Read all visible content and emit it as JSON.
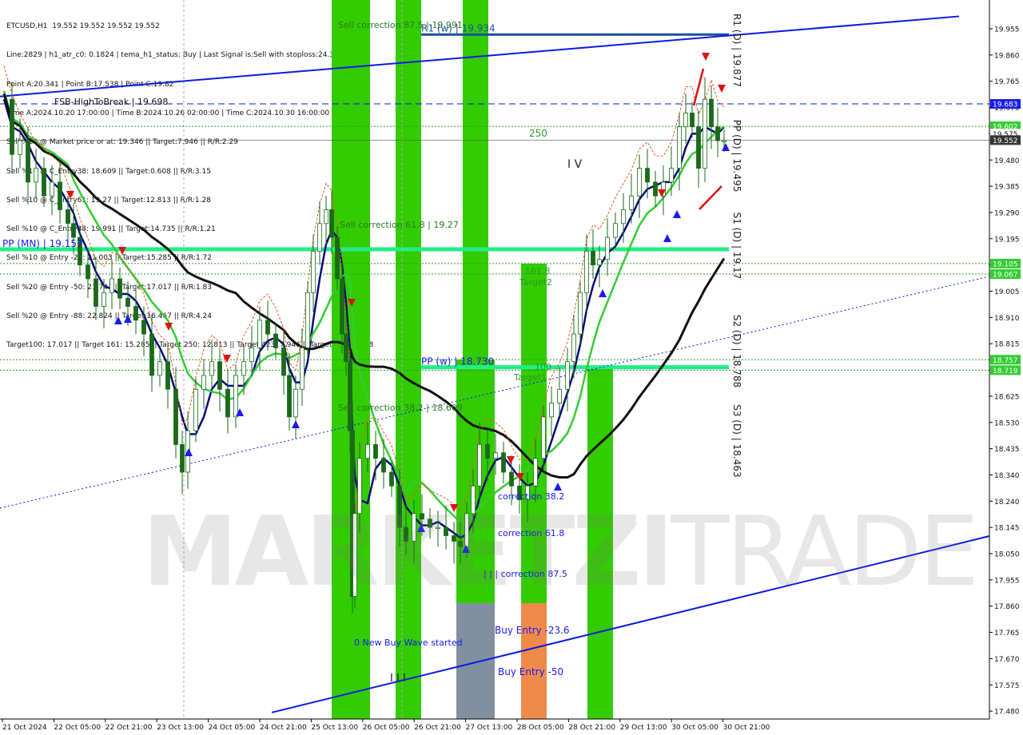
{
  "header": {
    "lines": [
      "ETCUSD,H1  19.552 19.552 19.552 19.552",
      "Line:2829 | h1_atr_c0: 0.1824 | tema_h1_status: Buy | Last Signal is:Sell with stoploss:24.323",
      "Point A:20.341 | Point B:17.538 | Point C:19.82",
      "Time A:2024.10.20 17:00:00 | Time B:2024.10.26 02:00:00 | Time C:2024.10.30 16:00:00",
      "Sell %20 @ Market price or at: 19.346 || Target:7.946 || R/R:2.29",
      "Sell %10 @ C_Entry38: 18.609 || Target:0.608 || R/R:3.15",
      "Sell %10 @ C_Entry61: 19.27 || Target:12.813 || R/R:1.28",
      "Sell %10 @ C_Entry88: 19.991 || Target:14.735 || R/R:1.21",
      "Sell %10 @ Entry -23: 21.003 || Target:15.285 || R/R:1.72",
      "Sell %20 @ Entry -50: 21.743 || Target:17.017 || R/R:1.83",
      "Sell %20 @ Entry -88: 22.824 || Target:16.467 || R/R:4.24",
      "Target100: 17.017 || Target 161: 15.285 || Target 250: 12.813 || Target 423: 7.946 || Target 685: 0.608"
    ]
  },
  "watermark": {
    "bold": "MARKETZI",
    "thin": "TRADE"
  },
  "colors": {
    "bg": "#ffffff",
    "green_zone": "#33cc00",
    "orange_zone": "#f08a4b",
    "gray_zone": "#8090a0",
    "blue": "#0a1ae6",
    "pivot": "#1a4fa0",
    "pivot_green": "#22ee88",
    "price_tag": "#333333",
    "green_tag": "#33cc33",
    "blue_tag": "#1a1aee"
  },
  "chart_data": {
    "type": "candlestick",
    "symbol": "ETCUSD",
    "timeframe": "H1",
    "ylim": [
      17.48,
      20.0
    ],
    "y_ticks": [
      "19.955",
      "19.860",
      "19.765",
      "19.670",
      "19.575",
      "19.480",
      "19.385",
      "19.290",
      "19.195",
      "19.100",
      "19.005",
      "18.910",
      "18.815",
      "18.720",
      "18.625",
      "18.530",
      "18.435",
      "18.340",
      "18.240",
      "18.145",
      "18.050",
      "17.955",
      "17.860",
      "17.765",
      "17.670",
      "17.575",
      "17.480"
    ],
    "x_ticks": [
      "21 Oct 2024",
      "22 Oct 05:00",
      "22 Oct 21:00",
      "23 Oct 13:00",
      "24 Oct 05:00",
      "24 Oct 21:00",
      "25 Oct 13:00",
      "26 Oct 05:00",
      "26 Oct 21:00",
      "27 Oct 13:00",
      "28 Oct 05:00",
      "28 Oct 21:00",
      "29 Oct 13:00",
      "30 Oct 05:00",
      "30 Oct 21:00"
    ],
    "price_tags": [
      {
        "text": "19.683",
        "value": 19.683,
        "kind": "blue"
      },
      {
        "text": "19.602",
        "value": 19.602,
        "kind": "green"
      },
      {
        "text": "19.575",
        "value": 19.575,
        "kind": "plain"
      },
      {
        "text": "19.552",
        "value": 19.552,
        "kind": "dark"
      },
      {
        "text": "19.105",
        "value": 19.105,
        "kind": "green"
      },
      {
        "text": "19.067",
        "value": 19.067,
        "kind": "green"
      },
      {
        "text": "18.757",
        "value": 18.757,
        "kind": "green"
      },
      {
        "text": "18.719",
        "value": 18.719,
        "kind": "green"
      }
    ],
    "levels": [
      {
        "label": "R1 (w) | 19.934",
        "value": 19.934,
        "style": "weekly"
      },
      {
        "label": "PP (MN) | 19.157",
        "value": 19.157,
        "style": "monthly"
      },
      {
        "label": "PP (w) | 18.730",
        "value": 18.73,
        "style": "monthly"
      }
    ],
    "daily_pivots": [
      {
        "label": "R1 (D) | 19.877",
        "value": 19.877
      },
      {
        "label": "PP (D) | 19.495",
        "value": 19.495
      },
      {
        "label": "S1 (D) | 19.17",
        "value": 19.17
      },
      {
        "label": "S2 (D) | 18.788",
        "value": 18.788
      },
      {
        "label": "S3 (D) | 18.463",
        "value": 18.463
      }
    ],
    "annotations": [
      {
        "text": "Sell correction 87.5 | 19.991",
        "color": "#2a7a2a"
      },
      {
        "text": "Sell correction 61.8 | 19.27",
        "color": "#2a7a2a"
      },
      {
        "text": "Sell correction 38.2 | 18.609",
        "color": "#2a7a2a"
      },
      {
        "text": "250",
        "color": "#2a9a2a"
      },
      {
        "text": "161.8",
        "color": "#2a9a2a"
      },
      {
        "text": "Target2",
        "color": "#2a9a2a"
      },
      {
        "text": "100",
        "color": "#2a9a2a"
      },
      {
        "text": "Target1",
        "color": "#2a9a2a"
      },
      {
        "text": "I V",
        "color": "#222"
      },
      {
        "text": "I I I",
        "color": "#222"
      },
      {
        "text": "correction 38.2",
        "color": "#1a1aee"
      },
      {
        "text": "correction 61.8",
        "color": "#1a1aee"
      },
      {
        "text": "| | | correction 87.5",
        "color": "#1a1aee"
      },
      {
        "text": "0 New Buy Wave started",
        "color": "#1a1aee"
      },
      {
        "text": "Buy Entry -23.6",
        "color": "#1a1aee"
      },
      {
        "text": "Buy Entry -50",
        "color": "#1a1aee"
      },
      {
        "text": "FSB-HighToBreak | 19.698",
        "color": "#111"
      }
    ],
    "trend_channel": {
      "upper": [
        [
          0,
          19.71
        ],
        [
          1200,
          20.0
        ]
      ],
      "lower": [
        [
          340,
          17.48
        ],
        [
          1240,
          18.12
        ]
      ],
      "mid": [
        [
          0,
          18.22
        ],
        [
          1240,
          19.06
        ]
      ]
    },
    "close_path": [
      [
        5,
        19.7
      ],
      [
        15,
        19.5
      ],
      [
        25,
        19.55
      ],
      [
        35,
        19.4
      ],
      [
        45,
        19.45
      ],
      [
        55,
        19.35
      ],
      [
        65,
        19.4
      ],
      [
        75,
        19.3
      ],
      [
        85,
        19.25
      ],
      [
        92,
        19.2
      ],
      [
        100,
        19.1
      ],
      [
        110,
        19.05
      ],
      [
        120,
        18.95
      ],
      [
        130,
        19.0
      ],
      [
        140,
        19.05
      ],
      [
        150,
        18.98
      ],
      [
        160,
        18.95
      ],
      [
        170,
        18.9
      ],
      [
        180,
        18.85
      ],
      [
        190,
        18.7
      ],
      [
        200,
        18.75
      ],
      [
        210,
        18.65
      ],
      [
        220,
        18.45
      ],
      [
        228,
        18.35
      ],
      [
        235,
        18.5
      ],
      [
        245,
        18.65
      ],
      [
        255,
        18.7
      ],
      [
        265,
        18.75
      ],
      [
        275,
        18.65
      ],
      [
        285,
        18.55
      ],
      [
        295,
        18.7
      ],
      [
        305,
        18.75
      ],
      [
        315,
        18.8
      ],
      [
        325,
        18.9
      ],
      [
        335,
        18.85
      ],
      [
        345,
        18.8
      ],
      [
        355,
        18.7
      ],
      [
        362,
        18.55
      ],
      [
        370,
        18.65
      ],
      [
        378,
        18.8
      ],
      [
        385,
        19.0
      ],
      [
        392,
        19.15
      ],
      [
        400,
        19.25
      ],
      [
        408,
        19.3
      ],
      [
        415,
        19.2
      ],
      [
        422,
        19.05
      ],
      [
        428,
        18.85
      ],
      [
        433,
        18.75
      ],
      [
        438,
        18.5
      ],
      [
        441,
        17.9
      ],
      [
        444,
        18.2
      ],
      [
        450,
        18.4
      ],
      [
        460,
        18.45
      ],
      [
        470,
        18.4
      ],
      [
        480,
        18.35
      ],
      [
        490,
        18.3
      ],
      [
        500,
        18.15
      ],
      [
        508,
        18.1
      ],
      [
        518,
        18.2
      ],
      [
        528,
        18.18
      ],
      [
        538,
        18.15
      ],
      [
        548,
        18.15
      ],
      [
        558,
        18.12
      ],
      [
        568,
        18.1
      ],
      [
        576,
        18.08
      ],
      [
        584,
        18.2
      ],
      [
        592,
        18.3
      ],
      [
        600,
        18.45
      ],
      [
        610,
        18.4
      ],
      [
        620,
        18.42
      ],
      [
        630,
        18.35
      ],
      [
        640,
        18.3
      ],
      [
        650,
        18.25
      ],
      [
        660,
        18.3
      ],
      [
        670,
        18.4
      ],
      [
        680,
        18.55
      ],
      [
        690,
        18.6
      ],
      [
        700,
        18.65
      ],
      [
        710,
        18.75
      ],
      [
        718,
        18.85
      ],
      [
        726,
        19.0
      ],
      [
        734,
        19.15
      ],
      [
        742,
        19.1
      ],
      [
        750,
        19.12
      ],
      [
        760,
        19.2
      ],
      [
        770,
        19.25
      ],
      [
        780,
        19.3
      ],
      [
        790,
        19.35
      ],
      [
        800,
        19.45
      ],
      [
        810,
        19.4
      ],
      [
        820,
        19.35
      ],
      [
        830,
        19.4
      ],
      [
        840,
        19.45
      ],
      [
        850,
        19.6
      ],
      [
        858,
        19.65
      ],
      [
        866,
        19.6
      ],
      [
        874,
        19.45
      ],
      [
        882,
        19.7
      ],
      [
        890,
        19.6
      ],
      [
        898,
        19.55
      ],
      [
        906,
        19.55
      ]
    ]
  }
}
